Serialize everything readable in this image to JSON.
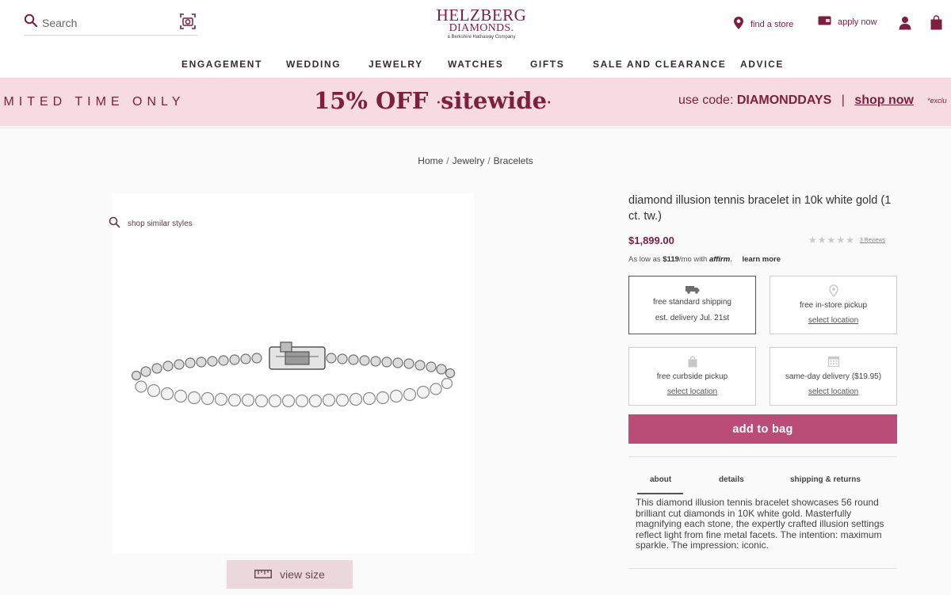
{
  "header": {
    "search_placeholder": "Search",
    "logo_line1": "HELZBERG",
    "logo_line2": "DIAMONDS.",
    "logo_tagline": "a Berkshire Hathaway Company",
    "find_store": "find a store",
    "apply_now": "apply now"
  },
  "nav": {
    "items": [
      "ENGAGEMENT",
      "WEDDING",
      "JEWELRY",
      "WATCHES",
      "GIFTS",
      "SALE AND CLEARANCE",
      "ADVICE"
    ]
  },
  "promo": {
    "left_text": "IMITED TIME ONLY",
    "headline_discount": "15% OFF",
    "headline_scope": "sitewide",
    "code_prefix": "use code:",
    "code": "DIAMONDDAYS",
    "separator": "|",
    "link": "shop now",
    "exclusions": "*exclu"
  },
  "breadcrumb": {
    "items": [
      "Home",
      "Jewelry",
      "Bracelets"
    ],
    "separator": "/"
  },
  "gallery": {
    "similar_label": "shop similar styles",
    "view_size_label": "view size"
  },
  "product": {
    "title": "diamond illusion tennis bracelet in 10k white gold (1 ct. tw.)",
    "price": "$1,899.00",
    "rating": 0,
    "reviews": "3 Reviews",
    "financing_prefix": "As low as",
    "financing_amount": "$119",
    "financing_suffix": "/mo with",
    "financing_brand": "affirm",
    "learn_more": "learn more"
  },
  "fulfillment": {
    "standard": {
      "line1": "free standard shipping",
      "line2": "est. delivery Jul. 21st"
    },
    "instore": {
      "line1": "free in-store pickup",
      "link": "select location"
    },
    "curbside": {
      "line1": "free curbside pickup",
      "link": "select location"
    },
    "sameday": {
      "line1": "same-day delivery ($19.95)",
      "link": "select location"
    }
  },
  "actions": {
    "add_to_bag": "add to bag"
  },
  "tabs": {
    "about": "about",
    "details": "details",
    "shipping": "shipping & returns"
  },
  "about_text": "This diamond illusion tennis bracelet showcases 56 round brilliant cut diamonds in 10K white gold. Masterfully magnifying each stone, the expertly crafted illusion settings reflect light from fine metal facets. The intention: maximum sparkle. The impression: iconic.",
  "colors": {
    "brand": "#7d1f3e",
    "promo_bg": "#f6dbe1",
    "add_to_bag_bg": "#b94d78"
  }
}
